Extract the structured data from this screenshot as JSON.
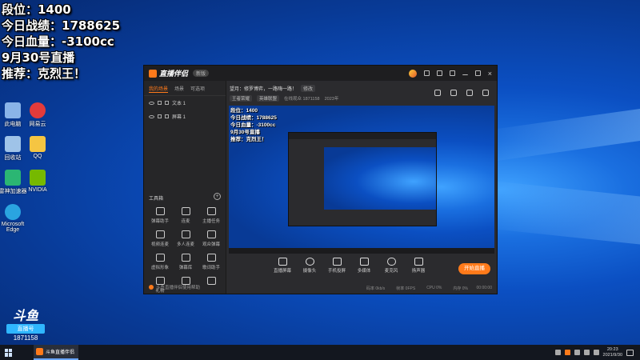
{
  "overlay": {
    "line1": "段位：1400",
    "line2": "今日战绩：1788625",
    "line3": "今日血量：-3100cc",
    "line4": "9月30号直播",
    "line5": "推荐：克烈王！"
  },
  "desktop": {
    "icons": [
      {
        "label": "此电脑",
        "icon": "computer-icon",
        "color": "#8ab4e8"
      },
      {
        "label": "网易云",
        "icon": "netease-music-icon",
        "color": "#e33b3b"
      },
      {
        "label": "回收站",
        "icon": "recycle-bin-icon",
        "color": "#9fc3e8"
      },
      {
        "label": "QQ",
        "icon": "qq-icon",
        "color": "#f5c542"
      },
      {
        "label": "雷神加速器",
        "icon": "accelerator-icon",
        "color": "#2bb673"
      },
      {
        "label": "NVIDIA",
        "icon": "nvidia-icon",
        "color": "#76b900"
      },
      {
        "label": "Microsoft Edge",
        "icon": "edge-icon",
        "color": "#2aa4e0"
      }
    ]
  },
  "app": {
    "title": "直播伴侣",
    "version": "新版",
    "left_tabs": [
      "我的场景",
      "场景",
      "可选项"
    ],
    "scenes": [
      "文本 1",
      "屏幕 1"
    ],
    "tools_title": "工具箱",
    "tools": [
      "弹幕助手",
      "连麦",
      "主播任务",
      "视频连麦",
      "多人连麦",
      "观众弹幕",
      "虚拟形象",
      "弹幕库",
      "歌词助手",
      "礼物",
      "",
      ""
    ],
    "footer_note": "斗鱼直播伴侣使用帮助",
    "room_title": "望月：修罗博弈，一路嗨一路！",
    "room_tag": "修改",
    "room_category": "王者荣耀",
    "room_sub": "英雄联盟",
    "viewers": "在线观众 1871158",
    "fans": "2023年",
    "preview": {
      "line1": "段位：1400",
      "line2": "今日战绩：1788625",
      "line3": "今日血量：-3100cc",
      "line4": "9月30号直播",
      "line5": "推荐：克烈王！"
    },
    "controls": [
      "直播屏幕",
      "摄像头",
      "手机投屏",
      "多媒体",
      "麦克风",
      "扬声器"
    ],
    "go_live": "开始直播",
    "status": [
      "码率 0kb/s",
      "帧率 0FPS",
      "CPU 0%",
      "内存 0%"
    ],
    "time": "00:00:00"
  },
  "watermark": {
    "logo": "斗鱼",
    "sub": "直播号",
    "id": "1871158"
  },
  "taskbar": {
    "app_label": "斗鱼直播伴侣",
    "time": "20:23",
    "date": "2021/9/30"
  }
}
